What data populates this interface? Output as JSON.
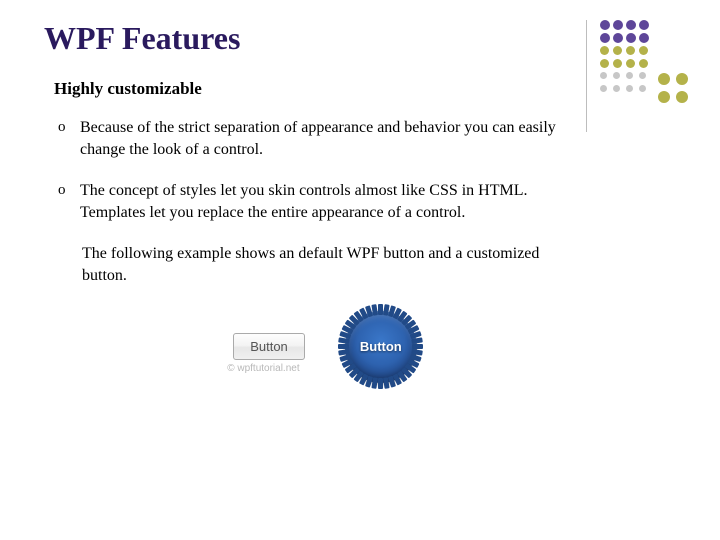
{
  "title": "WPF Features",
  "subtitle": "Highly customizable",
  "bullets": [
    "Because of the strict separation of appearance and behavior you can easily change the look of a control.",
    "The concept of styles let you skin controls almost like CSS in HTML. Templates let you replace the entire appearance of a control."
  ],
  "example_text": "The following example shows an default WPF button and a customized button.",
  "default_button_label": "Button",
  "custom_button_label": "Button",
  "credit": "© wpftutorial.net",
  "deco_colors": {
    "purple": "#5e4699",
    "olive": "#b4b24a",
    "grey": "#c7c7c7"
  }
}
